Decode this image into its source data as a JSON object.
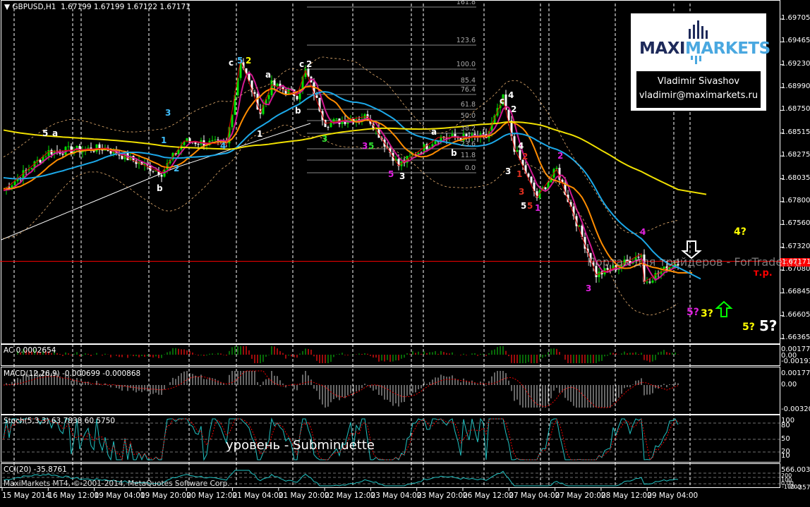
{
  "header": {
    "symbol": "GBPUSD,H1",
    "ohlc": "1.67199 1.67199 1.67122 1.67171"
  },
  "price_axis": [
    "1.69705",
    "1.69465",
    "1.69230",
    "1.68990",
    "1.68750",
    "1.68515",
    "1.68275",
    "1.68035",
    "1.67800",
    "1.67560",
    "1.67320",
    "1.67080",
    "1.66845",
    "1.66605",
    "1.66365"
  ],
  "current_price": "1.67171",
  "time_axis": [
    "15 May 2014",
    "16 May 12:00",
    "19 May 04:00",
    "19 May 20:00",
    "20 May 12:00",
    "21 May 04:00",
    "21 May 20:00",
    "22 May 12:00",
    "23 May 04:00",
    "23 May 20:00",
    "26 May 12:00",
    "27 May 04:00",
    "27 May 20:00",
    "28 May 12:00",
    "29 May 04:00"
  ],
  "fib_levels": [
    "161.8",
    "123.6",
    "100.0",
    "85.4",
    "76.4",
    "61.8",
    "50.0",
    "38.2",
    "23.6",
    "11.8",
    "0.0"
  ],
  "logo": {
    "text_a": "MAXI",
    "text_b": "MARKETS",
    "name": "Vladimir Sivashov",
    "email": "vladimir@maximarkets.ru"
  },
  "watermark": "Портал для трейдеров - ForTrader.ru",
  "annotation_tr": "т.р.",
  "wave_labels": [
    "5",
    "a",
    "c",
    "5",
    "2",
    "a",
    "c",
    "2",
    "b",
    "1",
    "3",
    "1",
    "b",
    "2",
    "4",
    "3",
    "3",
    "5",
    "5",
    "3",
    "a",
    "b",
    "c",
    "4",
    "2",
    "4",
    "2",
    "3",
    "1",
    "3",
    "5",
    "5",
    "1",
    "2",
    "3",
    "4",
    "4?",
    "5?",
    "3?",
    "5?",
    "5?"
  ],
  "indicators": {
    "ac": {
      "label": "AC 0.0002654",
      "axis": [
        "0.0017701",
        "0.00",
        "-0.001931"
      ]
    },
    "macd": {
      "label": "MACD(12,26,9) -0.000699 -0.000868",
      "axis": [
        "0.00177",
        "0.00",
        "-0.003201"
      ]
    },
    "stoch": {
      "label": "Stoch(5,3,3) 63.7838 60.5750",
      "axis": [
        "100",
        "80",
        "50",
        "20",
        "10"
      ],
      "overlay_text": "уровень - Subminuette"
    },
    "cci": {
      "label": "CCI(20) -35.8761",
      "axis": [
        "566.0035",
        "200",
        "100",
        "0.00",
        "-100",
        "-200",
        "-357"
      ]
    }
  },
  "copyright": "MaxiMarkets MT4, © 2001-2014, MetaQuotes Software Corp.",
  "colors": {
    "bull": "#00e000",
    "bear": "#ffffff",
    "ma_fast": "#d01890",
    "ma_mid": "#ff8c00",
    "ma_slow": "#1ca8e8",
    "ma_long": "#f0e000",
    "current": "#ff0000",
    "grid": "#ffffff"
  },
  "chart_data": {
    "type": "candlestick",
    "ylim": [
      1.66365,
      1.69705
    ],
    "waypoints": [
      [
        0,
        1.67913
      ],
      [
        16,
        1.68319
      ],
      [
        36,
        1.68356
      ],
      [
        56,
        1.68098
      ],
      [
        64,
        1.6843
      ],
      [
        79,
        1.68393
      ],
      [
        84,
        1.69278
      ],
      [
        91,
        1.68725
      ],
      [
        95,
        1.6902
      ],
      [
        104,
        1.68909
      ],
      [
        107,
        1.69167
      ],
      [
        114,
        1.68614
      ],
      [
        129,
        1.68688
      ],
      [
        140,
        1.68172
      ],
      [
        154,
        1.68467
      ],
      [
        171,
        1.68467
      ],
      [
        177,
        1.68872
      ],
      [
        181,
        1.68356
      ],
      [
        189,
        1.6784
      ],
      [
        196,
        1.68135
      ],
      [
        210,
        1.6703
      ],
      [
        218,
        1.6712
      ],
      [
        226,
        1.67251
      ],
      [
        227,
        1.66956
      ],
      [
        239,
        1.67171
      ]
    ]
  }
}
